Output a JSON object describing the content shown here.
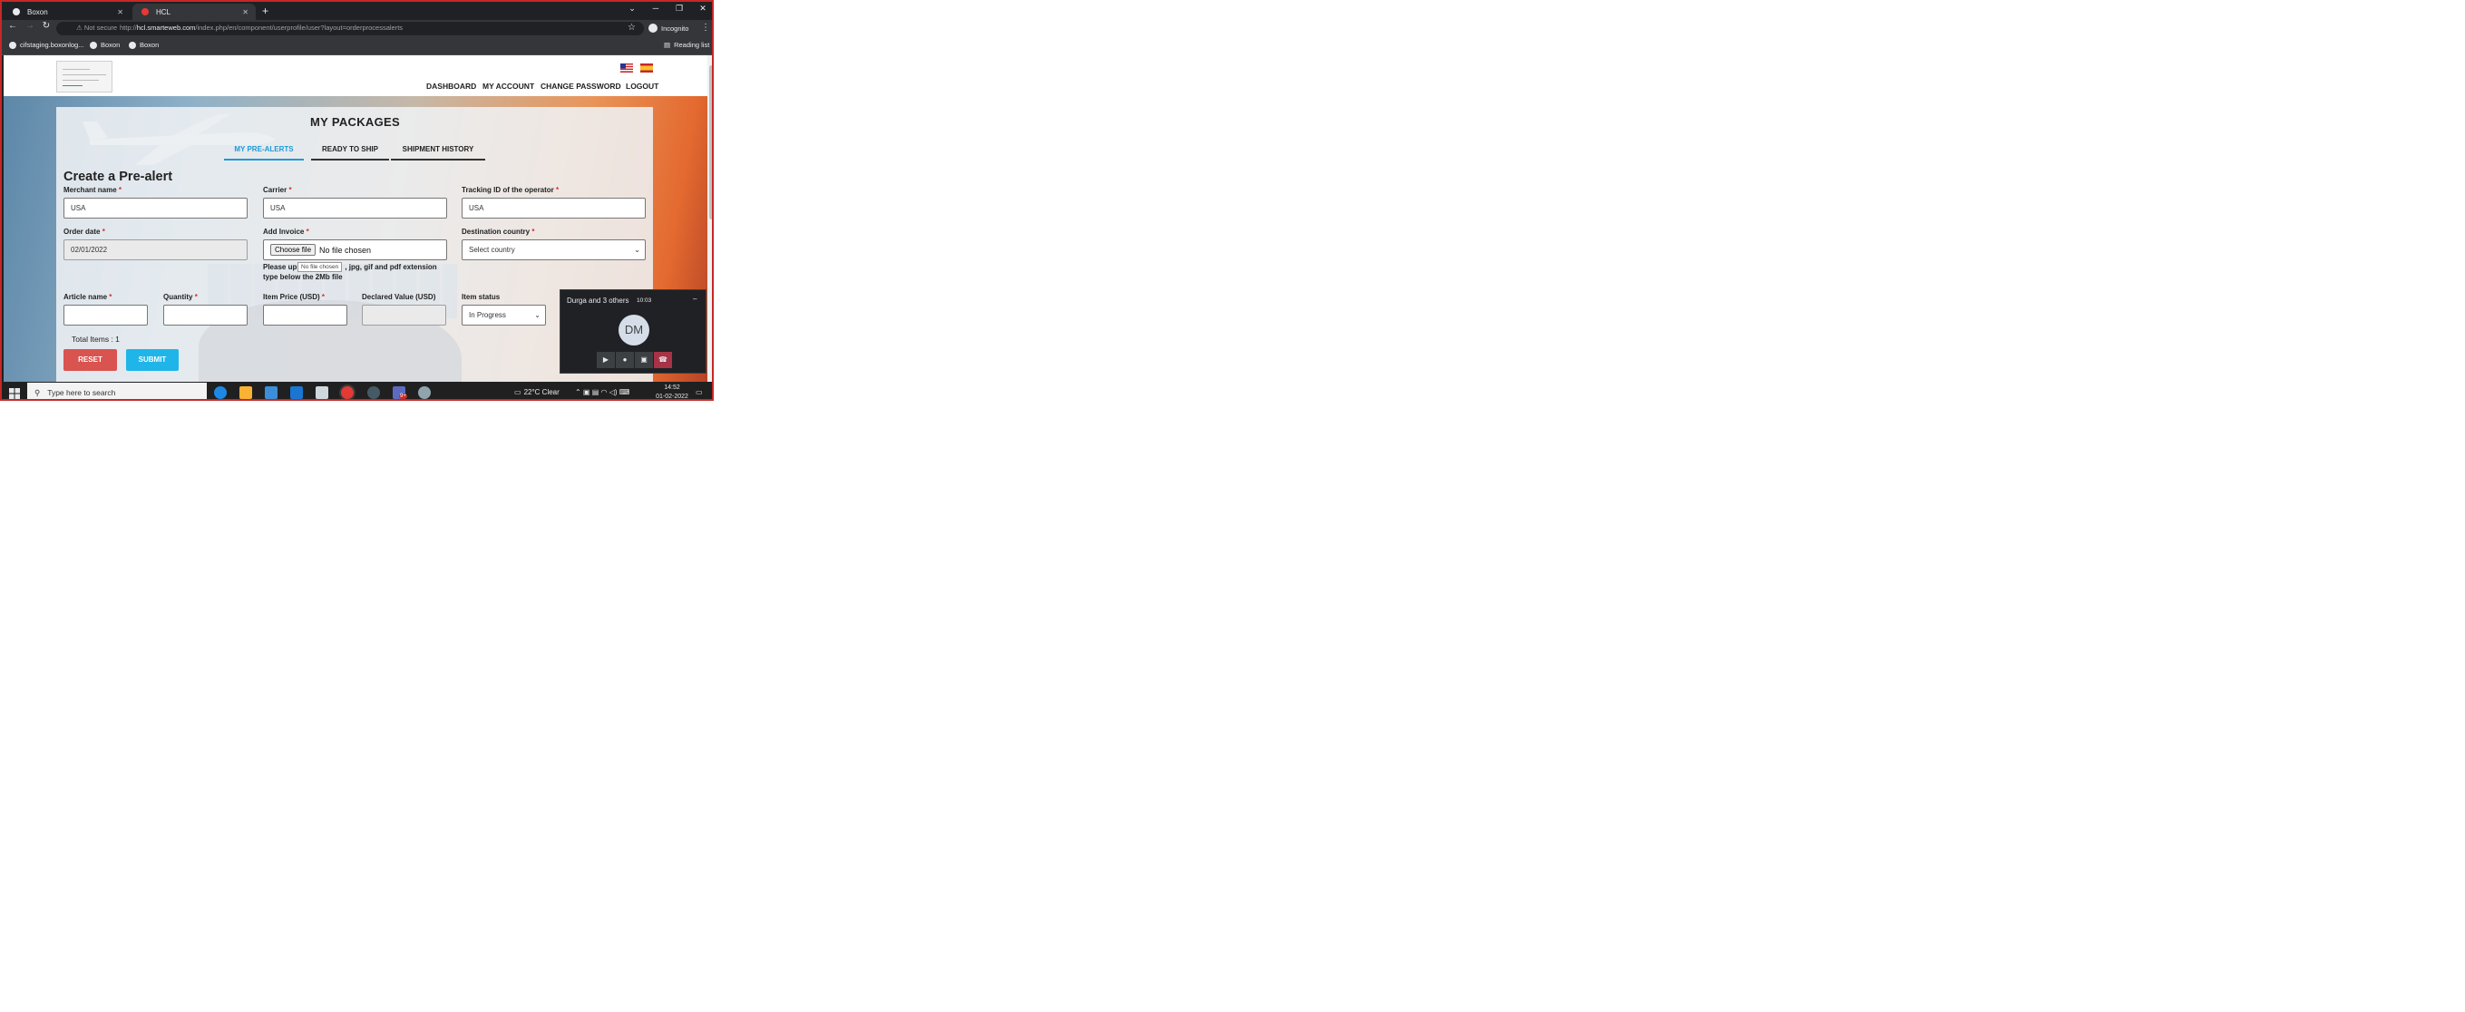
{
  "browser": {
    "tabs": [
      {
        "title": "Boxon",
        "active": false
      },
      {
        "title": "HCL",
        "active": true
      }
    ],
    "security_label": "Not secure",
    "url_host": "hcl.smarteweb.com",
    "url_path": "/index.php/en/component/userprofile/user?layout=orderprocessalerts",
    "url_scheme": "http://",
    "profile": "Incognito",
    "bookmarks": [
      "cifstaging.boxonlog...",
      "Boxon",
      "Boxon"
    ],
    "reading_list": "Reading list"
  },
  "site": {
    "nav": [
      "DASHBOARD",
      "MY ACCOUNT",
      "CHANGE PASSWORD",
      "LOGOUT"
    ],
    "flags": [
      "us-flag",
      "es-flag"
    ]
  },
  "page": {
    "title": "MY PACKAGES",
    "tabs": [
      "MY PRE-ALERTS",
      "READY TO SHIP",
      "SHIPMENT HISTORY"
    ],
    "active_tab": "MY PRE-ALERTS",
    "form_title": "Create a Pre-alert",
    "fields": {
      "merchant": {
        "label": "Merchant name",
        "value": "USA"
      },
      "carrier": {
        "label": "Carrier",
        "value": "USA"
      },
      "tracking": {
        "label": "Tracking ID of the operator",
        "value": "USA"
      },
      "order_date": {
        "label": "Order date",
        "value": "02/01/2022"
      },
      "invoice": {
        "label": "Add Invoice",
        "button": "Choose file",
        "status": "No file chosen"
      },
      "destination": {
        "label": "Destination country",
        "value": "Select country"
      },
      "article": {
        "label": "Article name",
        "value": ""
      },
      "quantity": {
        "label": "Quantity",
        "value": ""
      },
      "price": {
        "label": "Item Price (USD)",
        "value": ""
      },
      "declared": {
        "label": "Declared Value (USD)",
        "value": ""
      },
      "status": {
        "label": "Item status",
        "value": "In Progress"
      }
    },
    "required_mark": "*",
    "help_line1_a": "Please up",
    "help_line1_b": ", jpg, gif and pdf extension",
    "help_line2": "type below the 2Mb file",
    "tooltip": "No file chosen",
    "total_items": "Total Items : 1",
    "reset": "RESET",
    "submit": "SUBMIT"
  },
  "meet": {
    "caller": "Durga and 3 others",
    "time": "10:03",
    "initials": "DM",
    "minimize": "–"
  },
  "taskbar": {
    "search_placeholder": "Type here to search",
    "weather": "22°C  Clear",
    "time": "14:52",
    "date": "01-02-2022",
    "badge": "9+"
  },
  "colors": {
    "accent": "#1c9ad6",
    "reset": "#d9534f",
    "submit": "#1fb5e8",
    "required": "#d32f2f",
    "window_border": "#c62828",
    "hangup": "#a83246"
  }
}
